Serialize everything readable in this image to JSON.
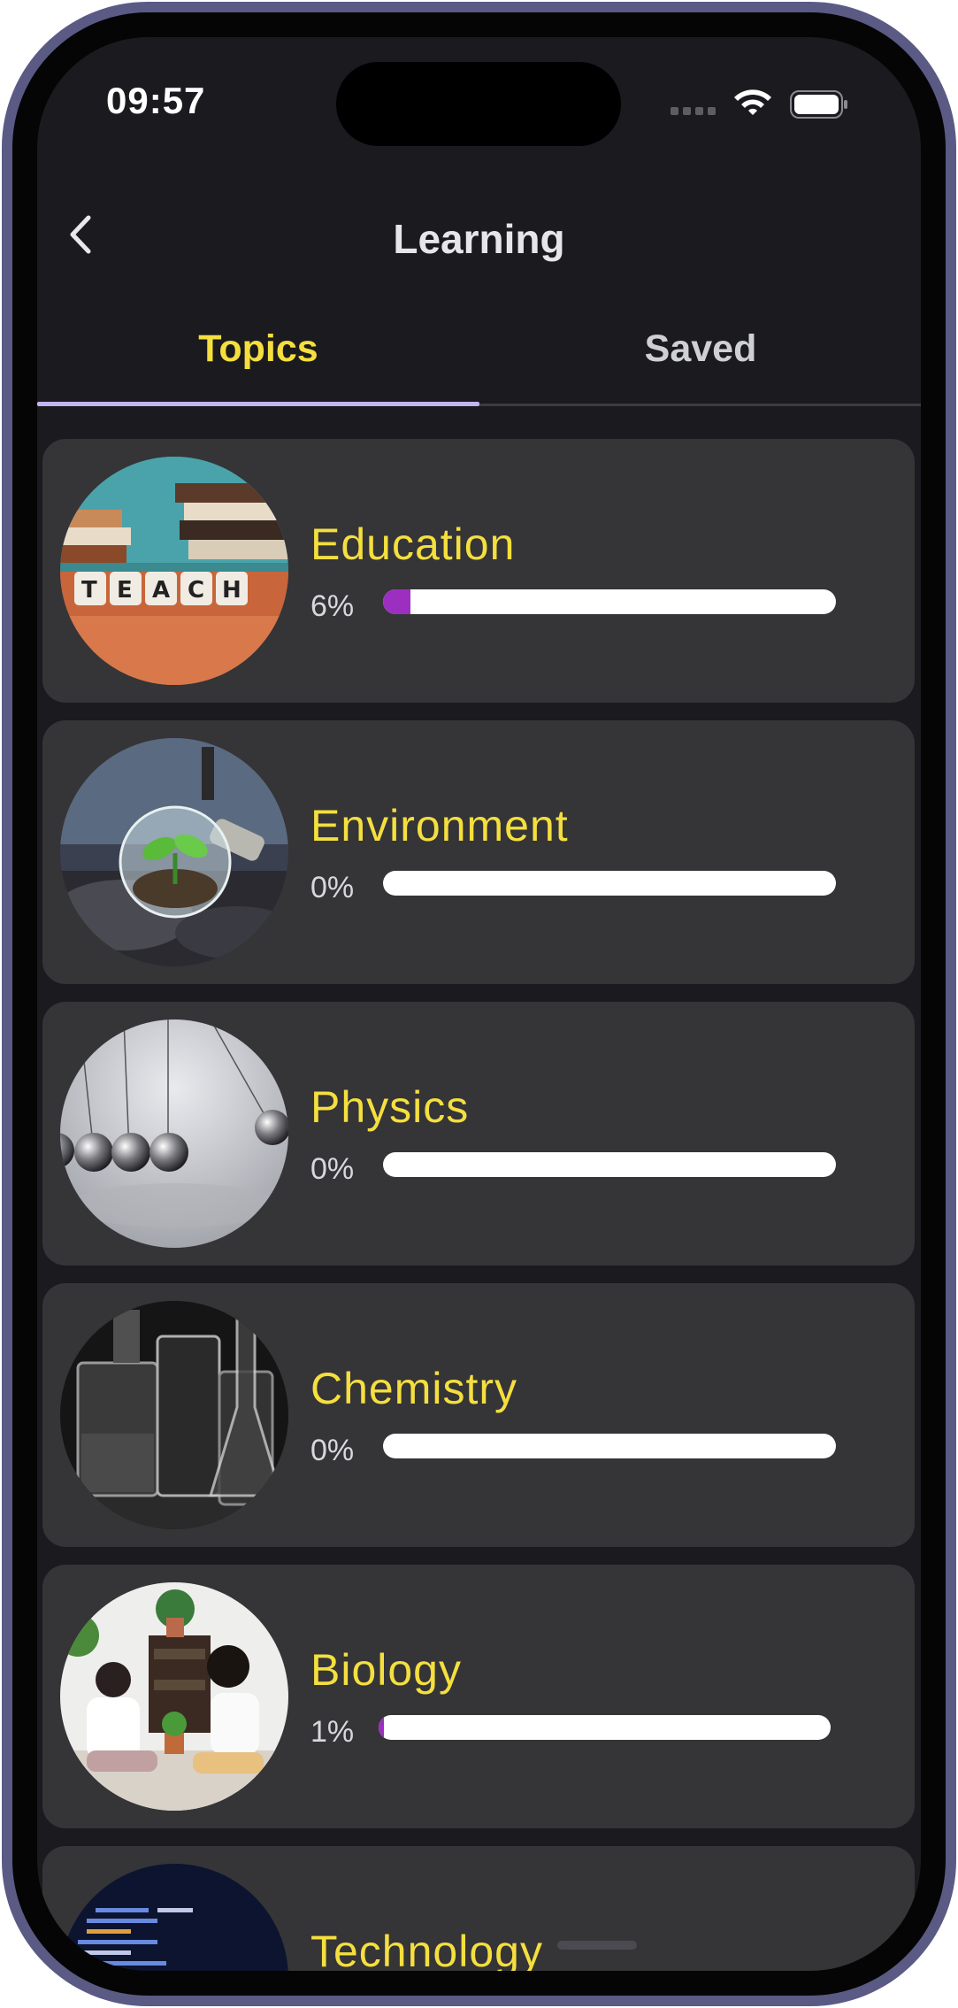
{
  "status_bar": {
    "time": "09:57"
  },
  "header": {
    "title": "Learning",
    "back_icon": "chevron-left-icon"
  },
  "tabs": [
    {
      "label": "Topics",
      "active": true
    },
    {
      "label": "Saved",
      "active": false
    }
  ],
  "topics": [
    {
      "title": "Education",
      "percent_label": "6%",
      "progress": 0.06,
      "image": "teach-blocks-photo"
    },
    {
      "title": "Environment",
      "percent_label": "0%",
      "progress": 0.0,
      "image": "plant-in-bulb-photo"
    },
    {
      "title": "Physics",
      "percent_label": "0%",
      "progress": 0.0,
      "image": "newtons-cradle-photo"
    },
    {
      "title": "Chemistry",
      "percent_label": "0%",
      "progress": 0.0,
      "image": "lab-glassware-photo"
    },
    {
      "title": "Biology",
      "percent_label": "1%",
      "progress": 0.01,
      "image": "children-with-plants-photo"
    },
    {
      "title": "Technology",
      "percent_label": "",
      "progress": null,
      "image": "code-screen-photo"
    }
  ],
  "colors": {
    "accent_yellow": "#f4df3e",
    "progress_fill": "#9c2fc0",
    "tab_indicator": "#c4b4f0",
    "card_bg": "#353437",
    "screen_bg": "#1b1a1f"
  }
}
